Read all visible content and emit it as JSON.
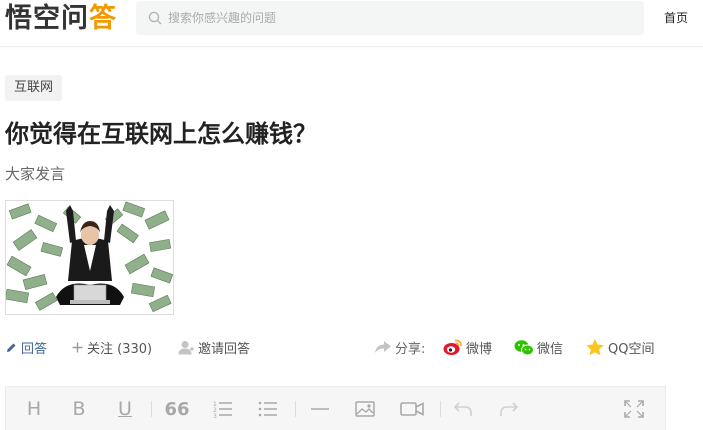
{
  "header": {
    "logo_part1": "悟空问",
    "logo_part2": "答",
    "search_placeholder": "搜索你感兴趣的问题",
    "home_link": "首页"
  },
  "question": {
    "tag": "互联网",
    "title": "你觉得在互联网上怎么赚钱？",
    "subtitle": "大家发言"
  },
  "actions": {
    "answer": "回答",
    "follow": "关注 (330)",
    "invite": "邀请回答",
    "share_label": "分享:",
    "weibo": "微博",
    "wechat": "微信",
    "qzone": "QQ空间"
  },
  "toolbar": {
    "heading": "H",
    "bold": "B",
    "underline": "U",
    "quote": "66"
  },
  "colors": {
    "logo_accent": "#f39800",
    "link_blue": "#406599",
    "weibo_red": "#e6162d",
    "wechat_green": "#2dc100",
    "qzone_yellow": "#fbc51d"
  }
}
